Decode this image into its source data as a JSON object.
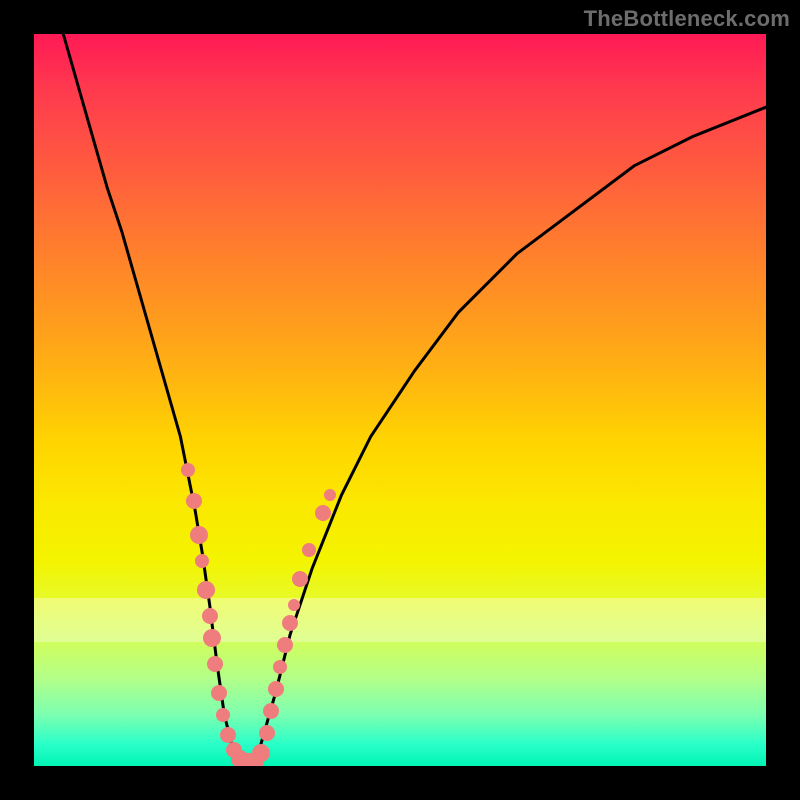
{
  "watermark": "TheBottleneck.com",
  "colors": {
    "curve_stroke": "#000000",
    "dot_fill": "#ef7d7d",
    "frame_bg": "#000000"
  },
  "chart_data": {
    "type": "line",
    "title": "",
    "xlabel": "",
    "ylabel": "",
    "xlim": [
      0,
      100
    ],
    "ylim": [
      0,
      100
    ],
    "grid": false,
    "curve": {
      "x": [
        4,
        6,
        8,
        10,
        12,
        14,
        16,
        18,
        20,
        22,
        23,
        24,
        25,
        26,
        27,
        28,
        29,
        30,
        31,
        33,
        35,
        38,
        42,
        46,
        52,
        58,
        66,
        74,
        82,
        90,
        100
      ],
      "y": [
        100,
        93,
        86,
        79,
        73,
        66,
        59,
        52,
        45,
        35,
        29,
        22,
        14,
        7,
        3,
        0,
        0,
        0,
        3,
        10,
        18,
        27,
        37,
        45,
        54,
        62,
        70,
        76,
        82,
        86,
        90
      ]
    },
    "dots": [
      {
        "x": 21.0,
        "y": 40.5,
        "r": 7
      },
      {
        "x": 21.8,
        "y": 36.2,
        "r": 8
      },
      {
        "x": 22.5,
        "y": 31.5,
        "r": 9
      },
      {
        "x": 23.0,
        "y": 28.0,
        "r": 7
      },
      {
        "x": 23.5,
        "y": 24.0,
        "r": 9
      },
      {
        "x": 24.0,
        "y": 20.5,
        "r": 8
      },
      {
        "x": 24.3,
        "y": 17.5,
        "r": 9
      },
      {
        "x": 24.7,
        "y": 14.0,
        "r": 8
      },
      {
        "x": 25.3,
        "y": 10.0,
        "r": 8
      },
      {
        "x": 25.8,
        "y": 7.0,
        "r": 7
      },
      {
        "x": 26.5,
        "y": 4.2,
        "r": 8
      },
      {
        "x": 27.3,
        "y": 2.2,
        "r": 8
      },
      {
        "x": 28.2,
        "y": 1.0,
        "r": 9
      },
      {
        "x": 29.2,
        "y": 0.6,
        "r": 9
      },
      {
        "x": 30.2,
        "y": 0.7,
        "r": 9
      },
      {
        "x": 31.0,
        "y": 1.8,
        "r": 9
      },
      {
        "x": 31.8,
        "y": 4.5,
        "r": 8
      },
      {
        "x": 32.4,
        "y": 7.5,
        "r": 8
      },
      {
        "x": 33.0,
        "y": 10.5,
        "r": 8
      },
      {
        "x": 33.6,
        "y": 13.5,
        "r": 7
      },
      {
        "x": 34.3,
        "y": 16.5,
        "r": 8
      },
      {
        "x": 35.0,
        "y": 19.5,
        "r": 8
      },
      {
        "x": 35.5,
        "y": 22.0,
        "r": 6
      },
      {
        "x": 36.3,
        "y": 25.5,
        "r": 8
      },
      {
        "x": 37.5,
        "y": 29.5,
        "r": 7
      },
      {
        "x": 39.5,
        "y": 34.5,
        "r": 8
      },
      {
        "x": 40.5,
        "y": 37.0,
        "r": 6
      }
    ]
  }
}
